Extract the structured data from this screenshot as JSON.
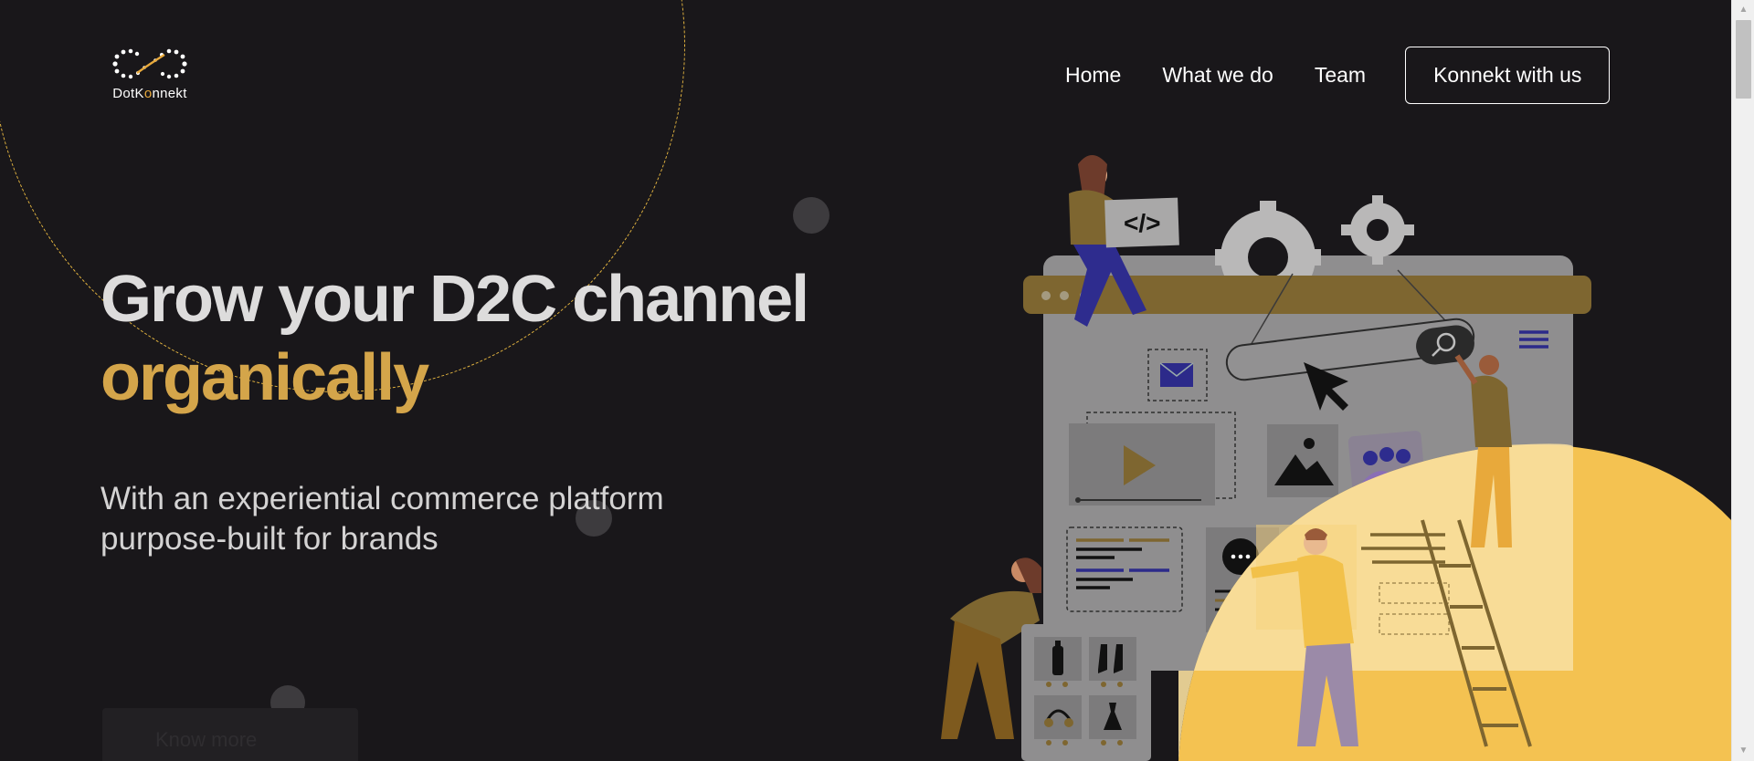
{
  "brand": {
    "name_pre": "DotK",
    "name_dot": "o",
    "name_post": "nnekt",
    "accent": "#e8a93b"
  },
  "nav": {
    "items": [
      {
        "label": "Home"
      },
      {
        "label": "What we do"
      },
      {
        "label": "Team"
      }
    ],
    "cta_label": "Konnekt with us"
  },
  "hero": {
    "title_line1": "Grow your D2C channel",
    "title_line2": "organically",
    "subtitle_line1": "With an experiential commerce platform",
    "subtitle_line2": "purpose-built for brands",
    "button_label": "Know more"
  },
  "illustration": {
    "code_tag": "</>",
    "icons": [
      "gear-icon",
      "search-icon",
      "hamburger-menu-icon",
      "mail-icon",
      "play-icon",
      "image-icon",
      "users-icon",
      "chat-icon",
      "bottle-icon",
      "boots-icon",
      "headphones-icon",
      "dress-icon"
    ]
  },
  "colors": {
    "background": "#19171a",
    "gold": "#d4a54a",
    "yellow_blob": "#f4c251",
    "heading": "#dddcdc"
  }
}
